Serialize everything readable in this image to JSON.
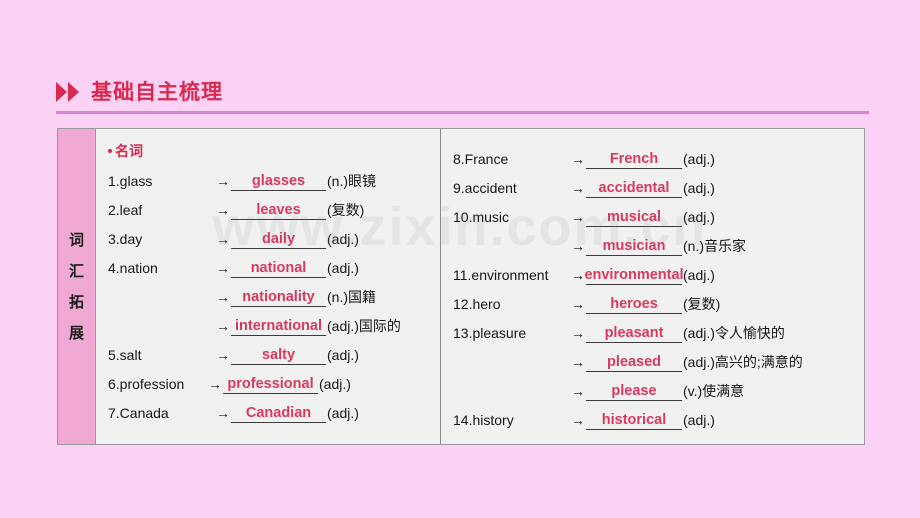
{
  "page": {
    "background_color": "#fbd2f6",
    "watermark": "www.zixin.com.cn"
  },
  "header": {
    "title": "基础自主梳理",
    "icon": "double-chevron-right-icon",
    "accent_color": "#d8294f",
    "rule_color": "#d26ac4"
  },
  "panel": {
    "background_color": "#f1f1f1",
    "border_color": "#9b9b9b",
    "sidebar": {
      "background_color": "#f0a8d4",
      "label": "词汇拓展",
      "chars": [
        "词",
        "汇",
        "拓",
        "展"
      ]
    },
    "answer_color": "#d83a5e",
    "left_column": {
      "category": "名词",
      "rows": [
        {
          "term": "1.glass",
          "arrow": "→",
          "answer": "glasses",
          "pos": "(n.)眼镜"
        },
        {
          "term": "2.leaf",
          "arrow": "→",
          "answer": "leaves",
          "pos": "(复数)"
        },
        {
          "term": "3.day",
          "arrow": "→",
          "answer": "daily",
          "pos": "(adj.)"
        },
        {
          "term": "4.nation",
          "arrow": "→",
          "answer": "national",
          "pos": "(adj.)"
        },
        {
          "term": "",
          "arrow": "→",
          "answer": "nationality",
          "pos": "(n.)国籍"
        },
        {
          "term": "",
          "arrow": "→",
          "answer": "international",
          "pos": "(adj.)国际的"
        },
        {
          "term": "5.salt",
          "arrow": "→",
          "answer": "salty",
          "pos": "(adj.)"
        },
        {
          "term": "6.profession",
          "arrow": "→",
          "answer": "professional",
          "pos": "(adj.)"
        },
        {
          "term": "7.Canada",
          "arrow": "→",
          "answer": "Canadian",
          "pos": "(adj.)"
        }
      ]
    },
    "right_column": {
      "rows": [
        {
          "term": "8.France",
          "arrow": "→",
          "answer": "French",
          "pos": "(adj.)"
        },
        {
          "term": "9.accident",
          "arrow": "→",
          "answer": "accidental",
          "pos": "(adj.)"
        },
        {
          "term": "10.music",
          "arrow": "→",
          "answer": "musical",
          "pos": "(adj.)"
        },
        {
          "term": "",
          "arrow": "→",
          "answer": "musician",
          "pos": "(n.)音乐家"
        },
        {
          "term": "11.environment",
          "arrow": "→",
          "answer": "environmental",
          "pos": "(adj.)"
        },
        {
          "term": "12.hero",
          "arrow": "→",
          "answer": "heroes",
          "pos": "(复数)"
        },
        {
          "term": "13.pleasure",
          "arrow": "→",
          "answer": "pleasant",
          "pos": "(adj.)令人愉快的"
        },
        {
          "term": "",
          "arrow": "→",
          "answer": "pleased",
          "pos": "(adj.)高兴的;满意的"
        },
        {
          "term": "",
          "arrow": "→",
          "answer": "please",
          "pos": "(v.)使满意"
        },
        {
          "term": "14.history",
          "arrow": "→",
          "answer": "historical",
          "pos": "(adj.)"
        }
      ]
    }
  }
}
